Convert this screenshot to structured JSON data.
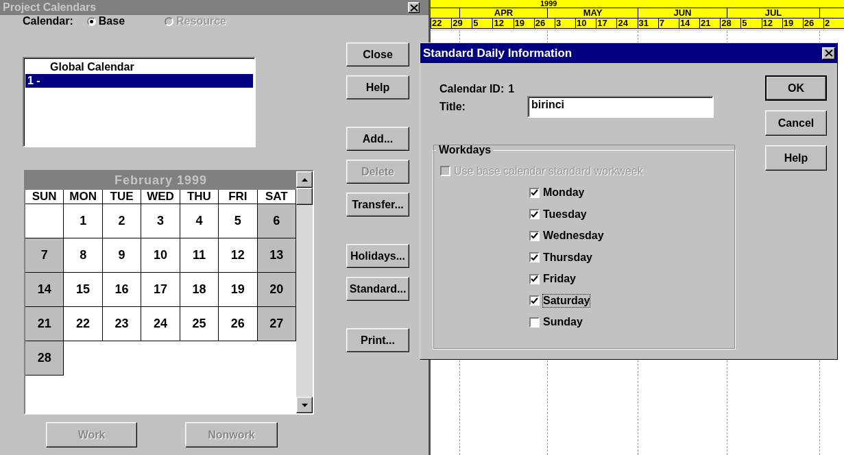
{
  "project_calendars": {
    "title": "Project Calendars",
    "calendar_label": "Calendar:",
    "calendar_types": [
      {
        "label": "Base",
        "selected": true,
        "disabled": false
      },
      {
        "label": "Resource",
        "selected": false,
        "disabled": true
      }
    ],
    "calendar_list": [
      {
        "label": "Global Calendar",
        "kind": "global",
        "selected": false
      },
      {
        "label": "1 -",
        "kind": "calendar",
        "selected": true
      }
    ],
    "month": {
      "title": "February 1999",
      "weekdays": [
        "SUN",
        "MON",
        "TUE",
        "WED",
        "THU",
        "FRI",
        "SAT"
      ],
      "days": [
        {
          "kind": "blank"
        },
        {
          "kind": "day",
          "day": "1",
          "nonwork": false
        },
        {
          "kind": "day",
          "day": "2",
          "nonwork": false
        },
        {
          "kind": "day",
          "day": "3",
          "nonwork": false
        },
        {
          "kind": "day",
          "day": "4",
          "nonwork": false
        },
        {
          "kind": "day",
          "day": "5",
          "nonwork": false
        },
        {
          "kind": "day",
          "day": "6",
          "nonwork": true
        },
        {
          "kind": "day",
          "day": "7",
          "nonwork": true
        },
        {
          "kind": "day",
          "day": "8",
          "nonwork": false
        },
        {
          "kind": "day",
          "day": "9",
          "nonwork": false
        },
        {
          "kind": "day",
          "day": "10",
          "nonwork": false
        },
        {
          "kind": "day",
          "day": "11",
          "nonwork": false
        },
        {
          "kind": "day",
          "day": "12",
          "nonwork": false
        },
        {
          "kind": "day",
          "day": "13",
          "nonwork": true
        },
        {
          "kind": "day",
          "day": "14",
          "nonwork": true
        },
        {
          "kind": "day",
          "day": "15",
          "nonwork": false
        },
        {
          "kind": "day",
          "day": "16",
          "nonwork": false
        },
        {
          "kind": "day",
          "day": "17",
          "nonwork": false
        },
        {
          "kind": "day",
          "day": "18",
          "nonwork": false
        },
        {
          "kind": "day",
          "day": "19",
          "nonwork": false
        },
        {
          "kind": "day",
          "day": "20",
          "nonwork": true
        },
        {
          "kind": "day",
          "day": "21",
          "nonwork": true
        },
        {
          "kind": "day",
          "day": "22",
          "nonwork": false
        },
        {
          "kind": "day",
          "day": "23",
          "nonwork": false
        },
        {
          "kind": "day",
          "day": "24",
          "nonwork": false
        },
        {
          "kind": "day",
          "day": "25",
          "nonwork": false
        },
        {
          "kind": "day",
          "day": "26",
          "nonwork": false
        },
        {
          "kind": "day",
          "day": "27",
          "nonwork": true
        },
        {
          "kind": "day",
          "day": "28",
          "nonwork": true
        }
      ]
    },
    "side_button_groups": [
      [
        {
          "label": "Close",
          "disabled": false
        },
        {
          "label": "Help",
          "disabled": false
        }
      ],
      [
        {
          "label": "Add...",
          "disabled": false
        },
        {
          "label": "Delete",
          "disabled": true
        },
        {
          "label": "Transfer...",
          "disabled": false
        }
      ],
      [
        {
          "label": "Holidays...",
          "disabled": false
        },
        {
          "label": "Standard...",
          "disabled": false
        }
      ],
      [
        {
          "label": "Print...",
          "disabled": false
        }
      ]
    ],
    "bottom_buttons": [
      {
        "label": "Work",
        "disabled": true
      },
      {
        "label": "Nonwork",
        "disabled": true
      }
    ]
  },
  "gantt": {
    "year": "1999",
    "months": [
      "APR",
      "MAY",
      "JUN",
      "JUL"
    ],
    "weeks": [
      "22",
      "29",
      "5",
      "12",
      "19",
      "26",
      "3",
      "10",
      "17",
      "24",
      "31",
      "7",
      "14",
      "21",
      "28",
      "5",
      "12",
      "19",
      "26",
      "2"
    ]
  },
  "standard_dialog": {
    "title": "Standard Daily Information",
    "calendar_id_label": "Calendar ID:",
    "calendar_id": "1",
    "title_label": "Title:",
    "title_value": "birinci",
    "workdays_label": "Workdays",
    "use_base": {
      "label": "Use base calendar standard workweek",
      "checked": false,
      "disabled": true
    },
    "days": [
      {
        "label": "Monday",
        "checked": true,
        "focused": false
      },
      {
        "label": "Tuesday",
        "checked": true,
        "focused": false
      },
      {
        "label": "Wednesday",
        "checked": true,
        "focused": false
      },
      {
        "label": "Thursday",
        "checked": true,
        "focused": false
      },
      {
        "label": "Friday",
        "checked": true,
        "focused": false
      },
      {
        "label": "Saturday",
        "checked": true,
        "focused": true
      },
      {
        "label": "Sunday",
        "checked": false,
        "focused": false
      }
    ],
    "buttons": [
      {
        "label": "OK",
        "default": true
      },
      {
        "label": "Cancel",
        "default": false
      },
      {
        "label": "Help",
        "default": false
      }
    ]
  }
}
